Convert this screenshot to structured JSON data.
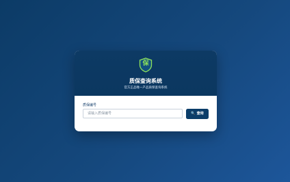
{
  "header": {
    "shield_char": "保",
    "title": "质保查询系统",
    "subtitle": "官方正品唯一产品质保查询系统"
  },
  "form": {
    "field_label": "质保编号",
    "input_placeholder": "请输入质保编号",
    "input_value": "",
    "query_label": "查询",
    "query_icon": "search-icon"
  },
  "colors": {
    "background": "#15487d",
    "header": "#0b3760",
    "accent_green": "#8fe35a",
    "button": "#0b3d69"
  }
}
